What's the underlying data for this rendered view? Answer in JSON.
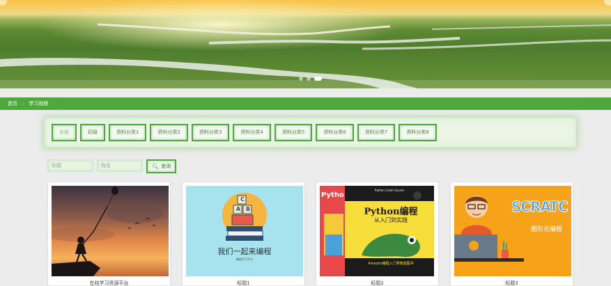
{
  "banner": {
    "dots": [
      false,
      false,
      true
    ]
  },
  "breadcrumb": {
    "home": "首页",
    "separator": ":",
    "current": "学习视频"
  },
  "categories": [
    {
      "label": "全部",
      "active": true
    },
    {
      "label": "初级"
    },
    {
      "label": "资料分类1"
    },
    {
      "label": "资料分类2"
    },
    {
      "label": "资料分类3"
    },
    {
      "label": "资料分类4"
    },
    {
      "label": "资料分类5"
    },
    {
      "label": "资料分类6"
    },
    {
      "label": "资料分类7"
    },
    {
      "label": "资料分类8"
    }
  ],
  "search": {
    "title_placeholder": "标题",
    "type_placeholder": "姓名",
    "button_label": "查询"
  },
  "cards": [
    {
      "title": "在线学习资源平台",
      "image": "silhouette-girl-balloon"
    },
    {
      "title": "标题1",
      "image": "coding-together",
      "image_text": {
        "main": "我们一起来编程",
        "sub": "编程学习平台",
        "letters": [
          "C",
          "A",
          "B"
        ]
      }
    },
    {
      "title": "标题2",
      "image": "python-books",
      "image_text": {
        "book_title": "Python编程",
        "book_subtitle": "从入门到实践",
        "book_tag": "Python Crash Course",
        "badge": "Amazon编程入门类榜首图书",
        "side": "Pytho"
      }
    },
    {
      "title": "标题3",
      "image": "scratch-kid",
      "image_text": {
        "logo": "SCRATC",
        "caption": "图形化编程"
      }
    }
  ],
  "colors": {
    "accent": "#4ea83d",
    "banner_sky": "#f7c348",
    "card2_bg": "#a6e3ee",
    "card4_bg": "#f6a31a"
  }
}
